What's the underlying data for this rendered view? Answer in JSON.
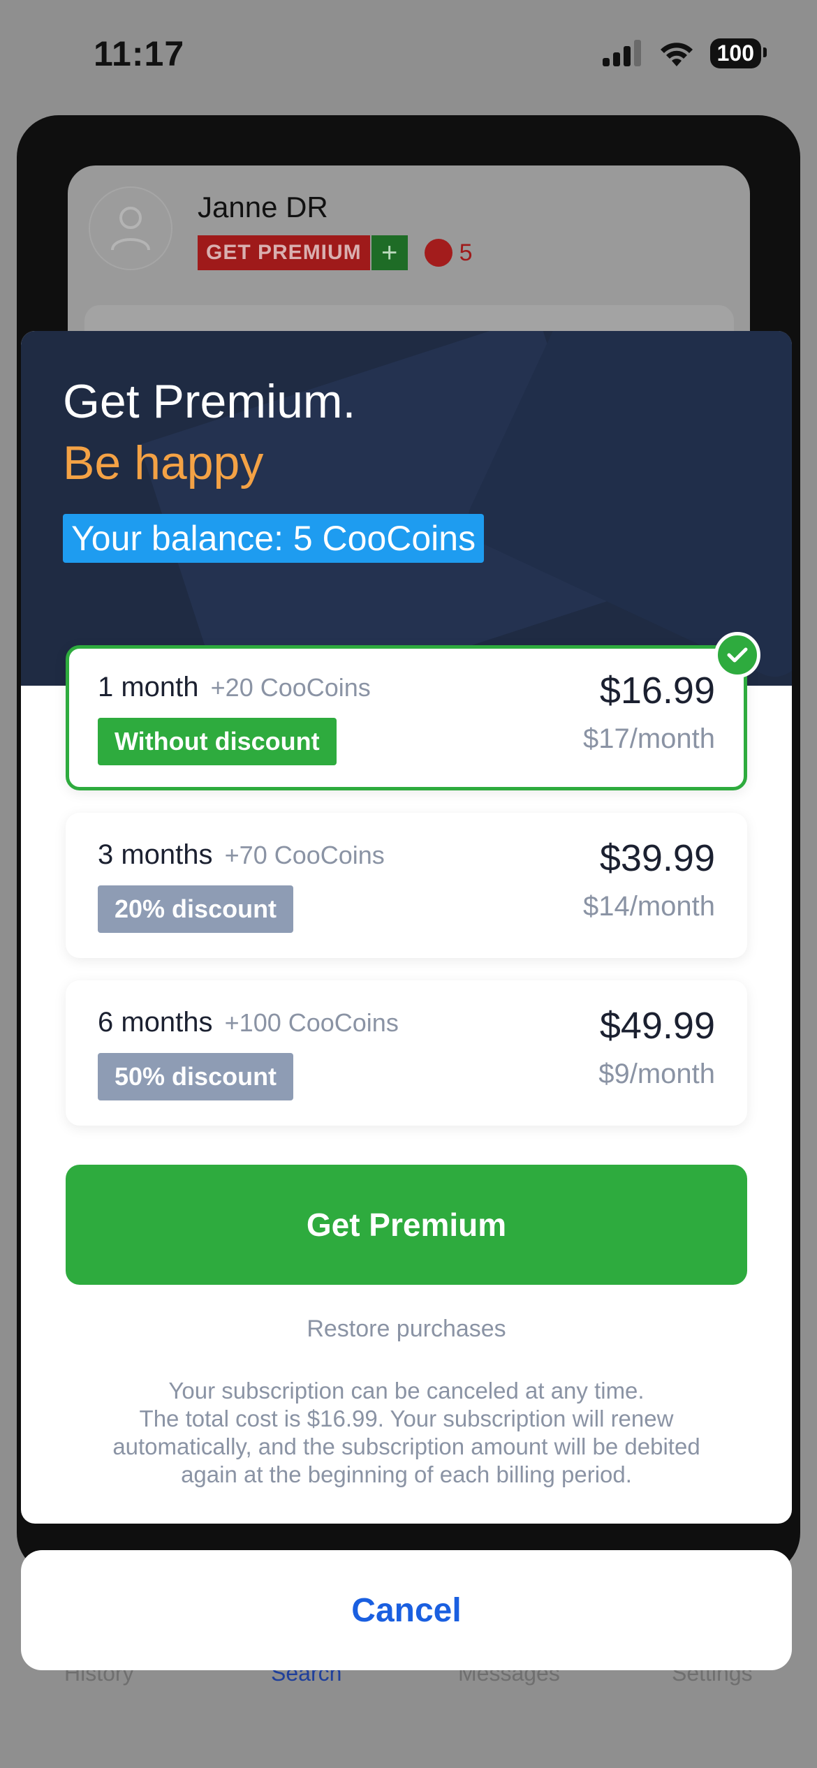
{
  "status_bar": {
    "time": "11:17",
    "battery": "100"
  },
  "background": {
    "profile_name": "Janne DR",
    "premium_badge": "GET PREMIUM",
    "plus_label": "+",
    "coin_count": "5"
  },
  "tab_bar": {
    "items": [
      {
        "label": "History",
        "active": false
      },
      {
        "label": "Search",
        "active": true
      },
      {
        "label": "Messages",
        "active": false
      },
      {
        "label": "Settings",
        "active": false
      }
    ]
  },
  "sheet": {
    "title": "Get Premium.",
    "subtitle": "Be happy",
    "balance": "Your balance: 5 CooCoins",
    "plans": [
      {
        "name": "1 month",
        "coins": "+20 CooCoins",
        "badge": "Without discount",
        "price": "$16.99",
        "monthly": "$17/month",
        "selected": true
      },
      {
        "name": "3 months",
        "coins": "+70 CooCoins",
        "badge": "20% discount",
        "price": "$39.99",
        "monthly": "$14/month",
        "selected": false
      },
      {
        "name": "6 months",
        "coins": "+100 CooCoins",
        "badge": "50% discount",
        "price": "$49.99",
        "monthly": "$9/month",
        "selected": false
      }
    ],
    "cta_label": "Get Premium",
    "restore_label": "Restore purchases",
    "legal_lines": [
      "Your subscription can be canceled at any time.",
      "The total cost is $16.99. Your subscription will renew",
      "automatically, and the subscription amount will be debited",
      "again at the beginning of each billing period."
    ]
  },
  "cancel_label": "Cancel",
  "colors": {
    "accent_green": "#2eab3e",
    "accent_orange": "#f4a245",
    "balance_blue": "#1e9cf0",
    "cancel_blue": "#1a5fe0",
    "hero_navy": "#1f2b43"
  }
}
